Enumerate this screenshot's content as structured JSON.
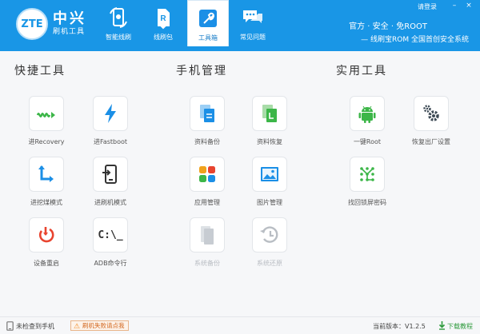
{
  "brand": {
    "logo_text": "ZTE",
    "name": "中兴",
    "subtitle": "刷机工具"
  },
  "nav": [
    {
      "label": "智能线刷",
      "icon": "smart-flash-icon"
    },
    {
      "label": "线刷包",
      "icon": "rom-package-icon"
    },
    {
      "label": "工具箱",
      "icon": "toolbox-icon"
    },
    {
      "label": "常见问题",
      "icon": "faq-chat-icon"
    }
  ],
  "header": {
    "login": "请登录",
    "minimize": "–",
    "close": "×",
    "slogan1": "官方 · 安全 · 免ROOT",
    "slogan2": "— 线刷宝ROM 全国首创安全系统"
  },
  "sections": {
    "quick": {
      "title": "快捷工具"
    },
    "phone": {
      "title": "手机管理"
    },
    "utility": {
      "title": "实用工具"
    }
  },
  "tools": {
    "recovery": "进Recovery",
    "fastboot": "进Fastboot",
    "edl": "进挖煤模式",
    "download_mode": "进刷机模式",
    "reboot": "设备重启",
    "adb": "ADB命令行",
    "adb_glyph": "C:\\_",
    "backup": "资料备份",
    "restore": "资料恢复",
    "apps": "应用管理",
    "pictures": "图片管理",
    "sys_backup": "系统备份",
    "sys_restore": "系统还原",
    "root": "一键Root",
    "factory_reset": "恢复出厂设置",
    "unlock": "找回锁屏密码"
  },
  "footer": {
    "status": "未检查到手机",
    "help": "刷机失败请点我",
    "version": "当前版本：V1.2.5",
    "download": "下载教程"
  },
  "colors": {
    "header": "#1996e6",
    "accent_green": "#3cb648",
    "accent_blue": "#1b8fe6"
  }
}
